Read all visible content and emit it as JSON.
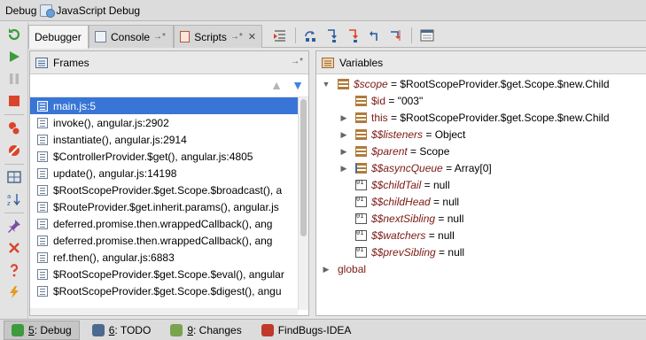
{
  "window": {
    "title": "Debug",
    "config_name": "JavaScript Debug"
  },
  "tabs": [
    {
      "label": "Debugger",
      "active": true
    },
    {
      "label": "Console",
      "pin": "→*"
    },
    {
      "label": "Scripts",
      "pin": "→*",
      "close": "✕"
    }
  ],
  "frames_panel": {
    "title": "Frames",
    "pin": "→*",
    "items": [
      {
        "label": "main.js:5",
        "selected": true
      },
      {
        "label": "invoke(), angular.js:2902"
      },
      {
        "label": "instantiate(), angular.js:2914"
      },
      {
        "label": "$ControllerProvider.$get(), angular.js:4805"
      },
      {
        "label": "update(), angular.js:14198"
      },
      {
        "label": "$RootScopeProvider.$get.Scope.$broadcast(), a"
      },
      {
        "label": "$RouteProvider.$get.inherit.params(), angular.js"
      },
      {
        "label": "deferred.promise.then.wrappedCallback(), ang"
      },
      {
        "label": "deferred.promise.then.wrappedCallback(), ang"
      },
      {
        "label": "ref.then(), angular.js:6883"
      },
      {
        "label": "$RootScopeProvider.$get.Scope.$eval(), angular"
      },
      {
        "label": "$RootScopeProvider.$get.Scope.$digest(), angu"
      }
    ]
  },
  "variables_panel": {
    "title": "Variables",
    "items": [
      {
        "depth": 0,
        "toggle": "open",
        "icon": "field-icon",
        "name": "$scope",
        "italic": true,
        "value": " = $RootScopeProvider.$get.Scope.$new.Child"
      },
      {
        "depth": 1,
        "toggle": "none",
        "icon": "field-icon",
        "name": "$id",
        "italic": false,
        "value": " = \"003\""
      },
      {
        "depth": 1,
        "toggle": "closed",
        "icon": "field-icon",
        "name": "this",
        "italic": false,
        "value": " = $RootScopeProvider.$get.Scope.$new.Child"
      },
      {
        "depth": 1,
        "toggle": "closed",
        "icon": "field-icon",
        "name": "$$listeners",
        "italic": true,
        "value": " = Object"
      },
      {
        "depth": 1,
        "toggle": "closed",
        "icon": "field-icon",
        "name": "$parent",
        "italic": true,
        "value": " = Scope"
      },
      {
        "depth": 1,
        "toggle": "closed",
        "icon": "array-icon",
        "name": "$$asyncQueue",
        "italic": true,
        "value": " = Array[0]"
      },
      {
        "depth": 1,
        "toggle": "none",
        "icon": "primitive-icon",
        "name": "$$childTail",
        "italic": true,
        "value": " = null"
      },
      {
        "depth": 1,
        "toggle": "none",
        "icon": "primitive-icon",
        "name": "$$childHead",
        "italic": true,
        "value": " = null"
      },
      {
        "depth": 1,
        "toggle": "none",
        "icon": "primitive-icon",
        "name": "$$nextSibling",
        "italic": true,
        "value": " = null"
      },
      {
        "depth": 1,
        "toggle": "none",
        "icon": "primitive-icon",
        "name": "$$watchers",
        "italic": true,
        "value": " = null"
      },
      {
        "depth": 1,
        "toggle": "none",
        "icon": "primitive-icon",
        "name": "$$prevSibling",
        "italic": true,
        "value": " = null"
      },
      {
        "depth": 0,
        "toggle": "closed",
        "icon": "none",
        "name": "global",
        "italic": false,
        "value": ""
      }
    ]
  },
  "statusbar": [
    {
      "mnemonic": "5",
      "label": ": Debug",
      "active": true,
      "icon": "debug-icon"
    },
    {
      "mnemonic": "6",
      "label": ": TODO",
      "active": false,
      "icon": "todo-icon"
    },
    {
      "mnemonic": "9",
      "label": ": Changes",
      "active": false,
      "icon": "changes-icon"
    },
    {
      "mnemonic": "",
      "label": "FindBugs-IDEA",
      "active": false,
      "icon": "findbugs-icon"
    }
  ],
  "colors": {
    "selection": "#3875d7",
    "var_name": "#7a1a14",
    "accent_green": "#3c9b3c",
    "accent_red": "#d9442b"
  }
}
